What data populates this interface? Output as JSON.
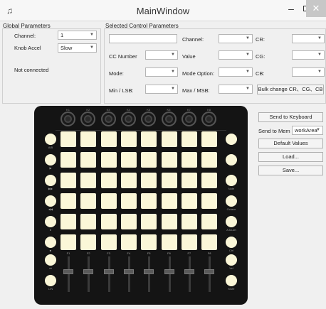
{
  "window": {
    "title": "MainWindow",
    "icon": "piano-icon"
  },
  "global": {
    "title": "Global Parameters",
    "channel_label": "Channel:",
    "channel_value": "1",
    "knob_accel_label": "Knob Accel",
    "knob_accel_value": "Slow",
    "status": "Not connected"
  },
  "selected": {
    "title": "Selected Control Parameters",
    "name_value": "",
    "labels": {
      "channel": "Channel:",
      "cr": "CR:",
      "cc_number": "CC Number",
      "value": "Value",
      "cg": "CG:",
      "mode": "Mode:",
      "mode_option": "Mode Option:",
      "cb": "CB:",
      "min_lsb": "Min / LSB:",
      "max_msb": "Max / MSB:"
    },
    "bulk_button": "Bulk change CR、CG、CB"
  },
  "actions": {
    "send_keyboard": "Send to Keyboard",
    "send_mem_label": "Send to Mem",
    "send_mem_value": "workArea",
    "default_values": "Default Values",
    "load": "Load...",
    "save": "Save..."
  },
  "device": {
    "knob_labels": [
      "K1",
      "K2",
      "K3",
      "K4",
      "K5",
      "K6",
      "K7",
      "K8"
    ],
    "fader_labels": [
      "F1",
      "F2",
      "F3",
      "F4",
      "F5",
      "F6",
      "F7",
      "F8"
    ],
    "left_labels": [
      "A/B",
      "▶",
      "▶▶",
      "◀◀",
      "●",
      "■",
      "⏮",
      "L/N"
    ],
    "right_labels": [
      "",
      "",
      "Note",
      "Octave",
      "A.touch",
      "Ctrl",
      "Vel",
      "Mute"
    ]
  }
}
